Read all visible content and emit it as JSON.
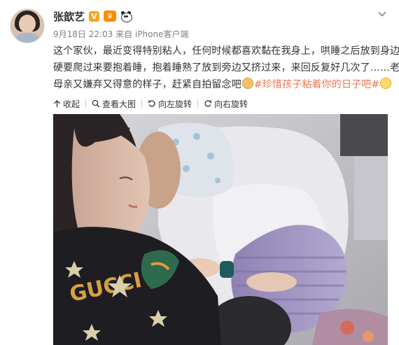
{
  "post": {
    "username": "张歆艺",
    "verified_badge": "V",
    "time": "9月18日 22:03",
    "source_prefix": "来自",
    "source": "iPhone客户端",
    "text_lines": [
      "这个家伙，最近变得特别粘人，任何时候都喜欢黏在我身上，哄睡之后放到身边",
      "硬要爬过来要抱着睡，抱着睡熟了放到旁边又挤过来，来回反复好几次了……老",
      "母亲又嫌弃又得意的样子，赶紧自拍留念吧"
    ],
    "hashtag": "#珍惜孩子粘着你的日子吧#",
    "icons": [
      "v-verified-icon",
      "crown-icon",
      "panda-icon",
      "chevron-down-icon",
      "emoji-cute-icon",
      "emoji-cry-icon"
    ]
  },
  "toolbar": {
    "collapse_label": "收起",
    "view_large_label": "查看大图",
    "rotate_left_label": "向左旋转",
    "rotate_right_label": "向右旋转"
  },
  "photo": {
    "shirt_text": "GUCCI"
  },
  "colors": {
    "hashtag": "#eb7350",
    "username": "#333333",
    "meta": "#808080"
  }
}
